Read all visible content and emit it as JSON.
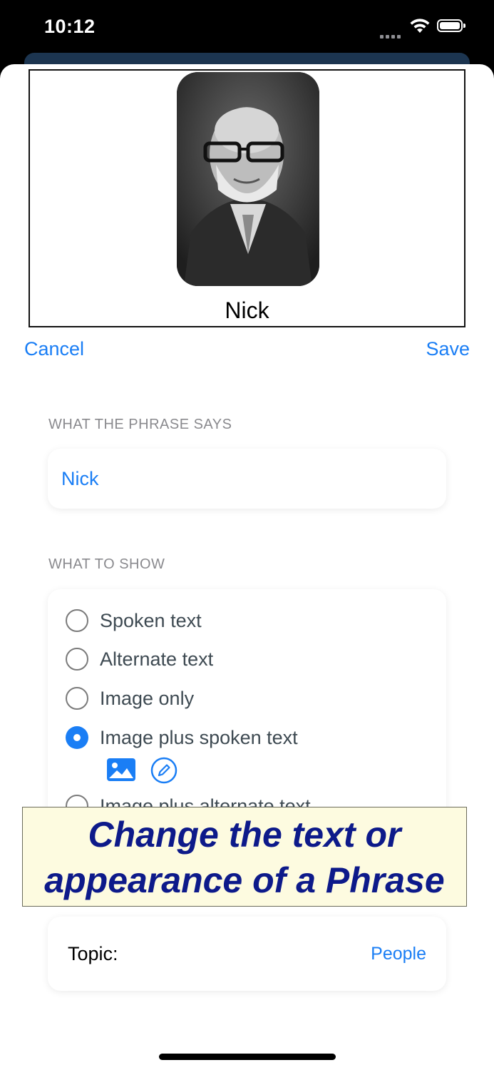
{
  "status_bar": {
    "time": "10:12"
  },
  "preview": {
    "name": "Nick"
  },
  "nav": {
    "cancel_label": "Cancel",
    "save_label": "Save"
  },
  "phrase_section": {
    "header": "WHAT THE PHRASE SAYS",
    "value": "Nick"
  },
  "show_section": {
    "header": "WHAT TO SHOW",
    "options": [
      {
        "label": "Spoken text",
        "selected": false
      },
      {
        "label": "Alternate text",
        "selected": false
      },
      {
        "label": "Image only",
        "selected": false
      },
      {
        "label": "Image plus spoken text",
        "selected": true
      },
      {
        "label": "Image plus alternate text",
        "selected": false
      }
    ],
    "icons": [
      "photo-library-icon",
      "pencil-circle-icon"
    ]
  },
  "banner": {
    "line1": "Change the text or",
    "line2": "appearance of a Phrase"
  },
  "topic": {
    "label": "Topic:",
    "value": "People"
  },
  "colors": {
    "accent": "#1a7ef5",
    "banner_bg": "#fdfbe0",
    "banner_text": "#0d1a8a"
  }
}
